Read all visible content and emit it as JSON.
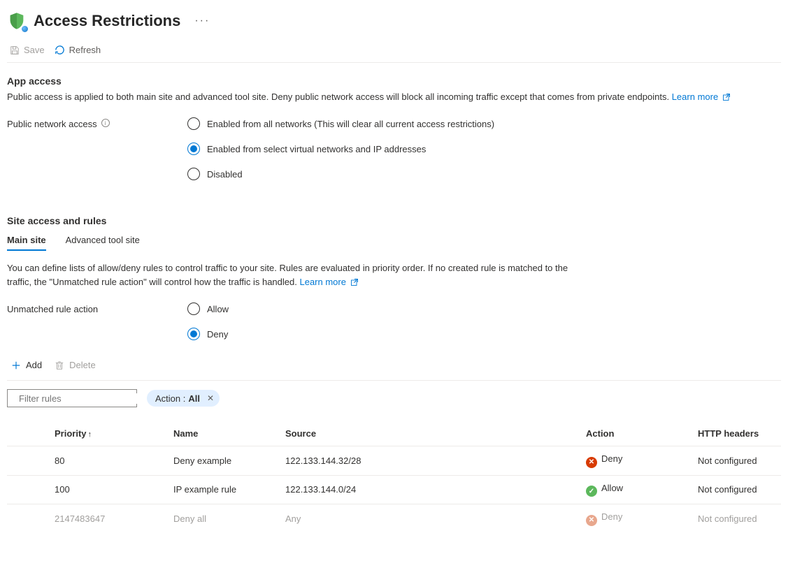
{
  "page_title": "Access Restrictions",
  "toolbar": {
    "save": "Save",
    "refresh": "Refresh"
  },
  "app_access": {
    "heading": "App access",
    "description": "Public access is applied to both main site and advanced tool site. Deny public network access will block all incoming traffic except that comes from private endpoints.",
    "learn_more": "Learn more",
    "field_label": "Public network access",
    "options": {
      "all": "Enabled from all networks (This will clear all current access restrictions)",
      "select": "Enabled from select virtual networks and IP addresses",
      "disabled": "Disabled"
    }
  },
  "site_access": {
    "heading": "Site access and rules",
    "tabs": {
      "main": "Main site",
      "advanced": "Advanced tool site"
    },
    "description": "You can define lists of allow/deny rules to control traffic to your site. Rules are evaluated in priority order. If no created rule is matched to the traffic, the \"Unmatched rule action\" will control how the traffic is handled.",
    "learn_more": "Learn more",
    "unmatched_label": "Unmatched rule action",
    "unmatched_options": {
      "allow": "Allow",
      "deny": "Deny"
    }
  },
  "rule_toolbar": {
    "add": "Add",
    "delete": "Delete"
  },
  "filter": {
    "placeholder": "Filter rules",
    "pill_label": "Action :",
    "pill_value": "All"
  },
  "table": {
    "headers": {
      "priority": "Priority",
      "name": "Name",
      "source": "Source",
      "action": "Action",
      "http": "HTTP headers"
    },
    "rows": [
      {
        "priority": "80",
        "name": "Deny example",
        "source": "122.133.144.32/28",
        "action": "Deny",
        "action_type": "deny",
        "http": "Not configured",
        "muted": false
      },
      {
        "priority": "100",
        "name": "IP example rule",
        "source": "122.133.144.0/24",
        "action": "Allow",
        "action_type": "allow",
        "http": "Not configured",
        "muted": false
      },
      {
        "priority": "2147483647",
        "name": "Deny all",
        "source": "Any",
        "action": "Deny",
        "action_type": "deny",
        "http": "Not configured",
        "muted": true
      }
    ]
  }
}
